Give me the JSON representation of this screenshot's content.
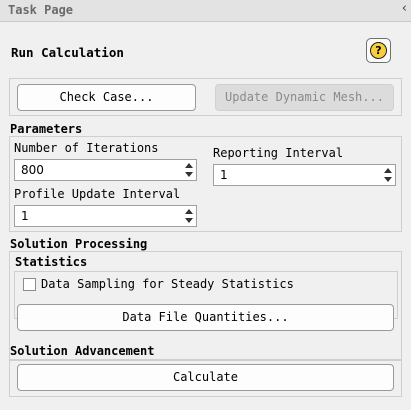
{
  "panel": {
    "title": "Task Page",
    "collapse_glyph": "‹"
  },
  "run": {
    "title": "Run Calculation",
    "help_glyph": "?",
    "check_case_label": "Check Case...",
    "update_mesh_label": "Update Dynamic Mesh..."
  },
  "parameters": {
    "title": "Parameters",
    "iterations_label": "Number of Iterations",
    "iterations_value": "800",
    "reporting_label": "Reporting Interval",
    "reporting_value": "1",
    "profile_label": "Profile Update Interval",
    "profile_value": "1"
  },
  "solution_processing": {
    "title": "Solution Processing",
    "statistics_title": "Statistics",
    "sampling_label": "Data Sampling for Steady Statistics",
    "sampling_checked": false,
    "data_file_label": "Data File Quantities..."
  },
  "solution_advancement": {
    "title": "Solution Advancement",
    "calculate_label": "Calculate"
  },
  "icons": {
    "help": "help-icon",
    "collapse": "chevron-left-icon",
    "spin_up": "arrow-up-icon",
    "spin_down": "arrow-down-icon"
  }
}
